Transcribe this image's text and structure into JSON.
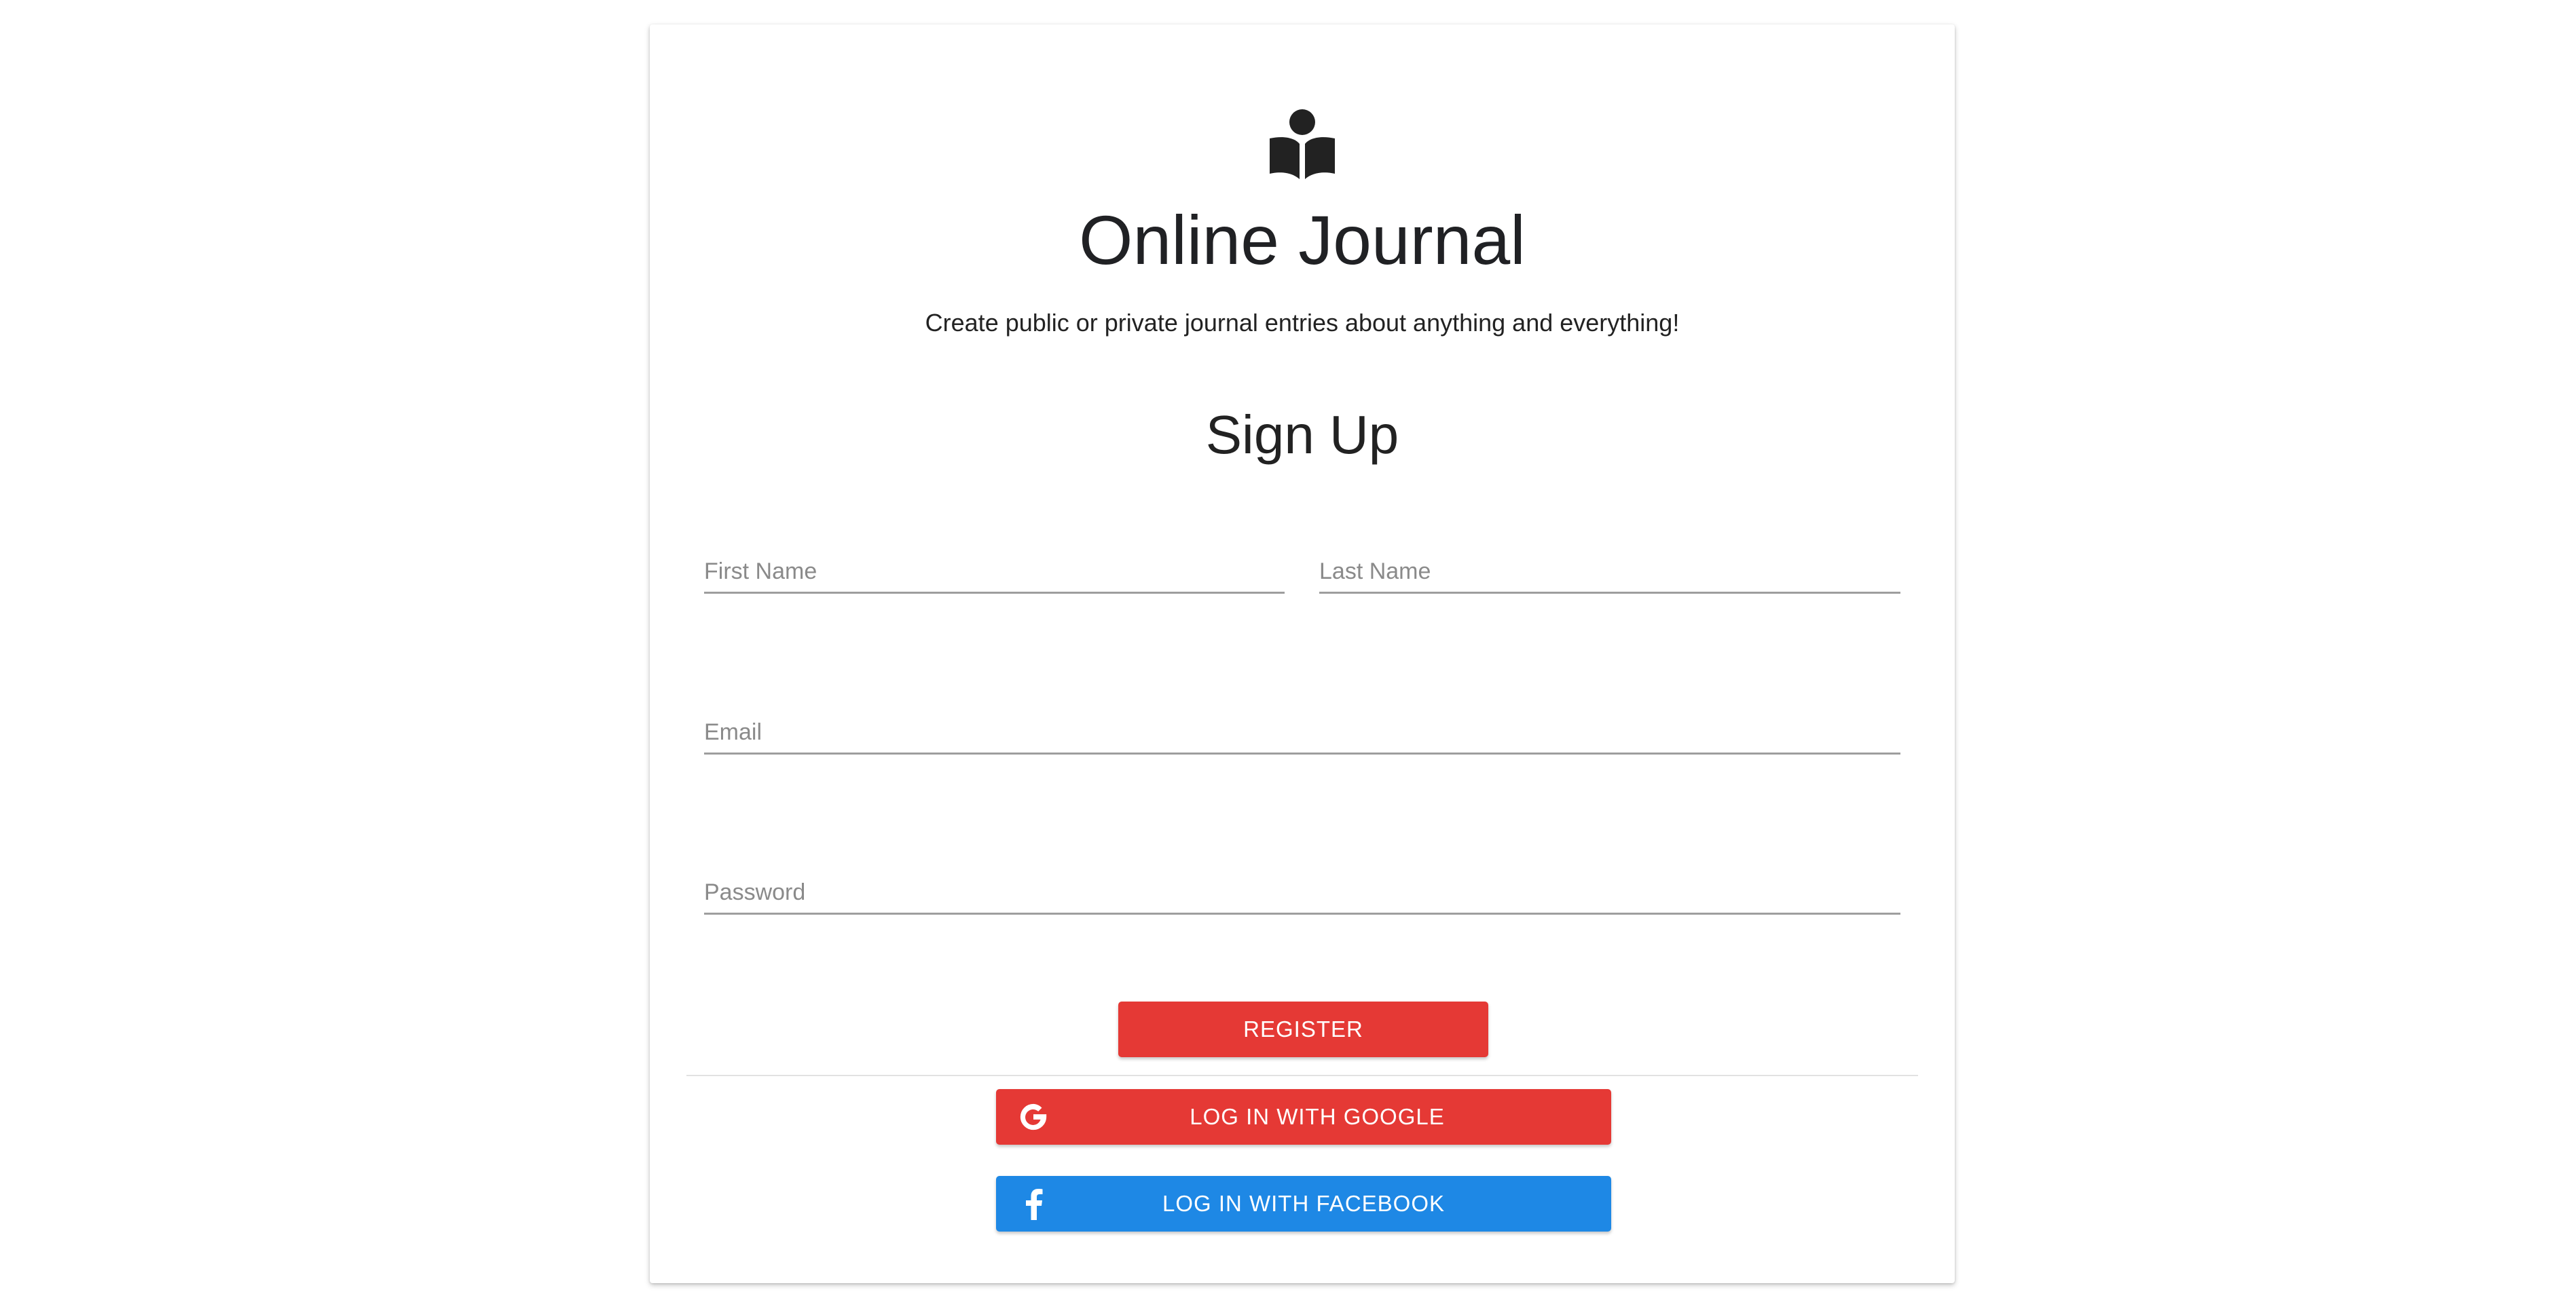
{
  "header": {
    "logo_icon": "reader-book-icon",
    "title": "Online Journal",
    "subtitle": "Create public or private journal entries about anything and everything!"
  },
  "form": {
    "heading": "Sign Up",
    "fields": {
      "first_name": {
        "placeholder": "First Name",
        "value": ""
      },
      "last_name": {
        "placeholder": "Last Name",
        "value": ""
      },
      "email": {
        "placeholder": "Email",
        "value": ""
      },
      "password": {
        "placeholder": "Password",
        "value": ""
      }
    },
    "register_label": "REGISTER"
  },
  "social": {
    "google": {
      "label": "LOG IN WITH GOOGLE",
      "icon": "google-icon",
      "color": "#e53935"
    },
    "facebook": {
      "label": "LOG IN WITH FACEBOOK",
      "icon": "facebook-icon",
      "color": "#1e88e5"
    }
  },
  "colors": {
    "primary_red": "#e53935",
    "facebook_blue": "#1e88e5",
    "input_underline": "#9e9e9e"
  }
}
